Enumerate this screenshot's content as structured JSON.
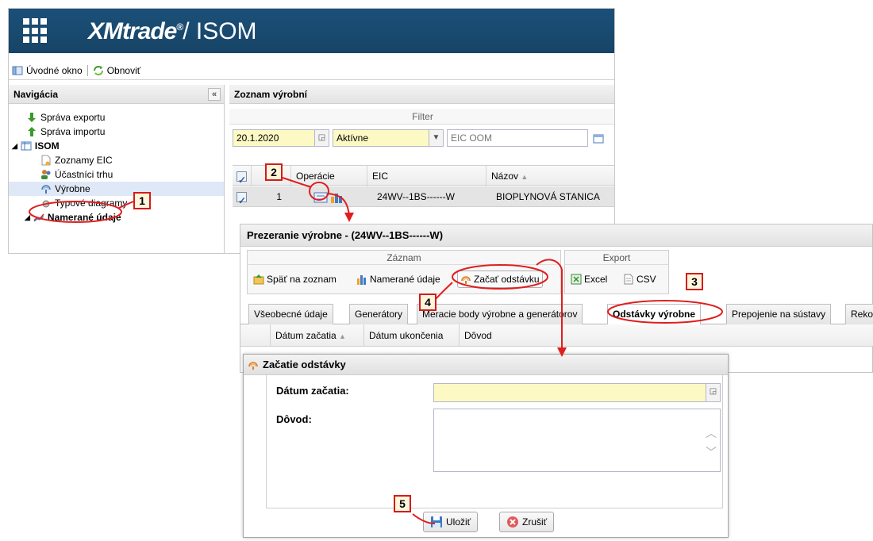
{
  "app": {
    "logo_main": "XMtrade",
    "logo_reg": "®",
    "logo_rest": "/ ISOM"
  },
  "toolbar": {
    "home_label": "Úvodné okno",
    "refresh_label": "Obnoviť"
  },
  "nav": {
    "title": "Navigácia",
    "collapse": "«",
    "items": [
      {
        "label": "Správa exportu"
      },
      {
        "label": "Správa importu"
      },
      {
        "label": "ISOM"
      },
      {
        "label": "Zoznamy EIC"
      },
      {
        "label": "Účastníci trhu"
      },
      {
        "label": "Výrobne"
      },
      {
        "label": "Typové diagramy"
      },
      {
        "label": "Namerané údaje"
      }
    ]
  },
  "list": {
    "title": "Zoznam výrobní",
    "filter_title": "Filter",
    "date_value": "20.1.2020",
    "status_value": "Aktívne",
    "eic_placeholder": "EIC OOM",
    "col_operations": "Operácie",
    "col_eic": "EIC",
    "col_name": "Názov",
    "rows": [
      {
        "num": "1",
        "eic": "24WV--1BS------W",
        "name": "BIOPLYNOVÁ STANICA"
      }
    ]
  },
  "detail": {
    "title": "Prezeranie výrobne - (24WV--1BS------W)",
    "group_record": "Záznam",
    "group_export": "Export",
    "back_label": "Späť na zoznam",
    "measured_label": "Namerané údaje",
    "start_outage_label": "Začať odstávku",
    "excel_label": "Excel",
    "csv_label": "CSV",
    "tabs": [
      "Všeobecné údaje",
      "Generátory",
      "Meracie body výrobne a generátorov",
      "Odstávky výrobne",
      "Prepojenie na sústavy",
      "Reko"
    ],
    "col_start": "Dátum začatia",
    "col_end": "Dátum ukončenia",
    "col_reason": "Dôvod"
  },
  "dialog": {
    "title": "Začatie odstávky",
    "start_label": "Dátum začatia:",
    "reason_label": "Dôvod:",
    "save_label": "Uložiť",
    "cancel_label": "Zrušiť"
  },
  "markers": [
    "1",
    "2",
    "3",
    "4",
    "5"
  ],
  "colors": {
    "header_blue": "#1a4a72",
    "annotation_red": "#e01e1e",
    "required_yellow": "#fdf9c4"
  }
}
